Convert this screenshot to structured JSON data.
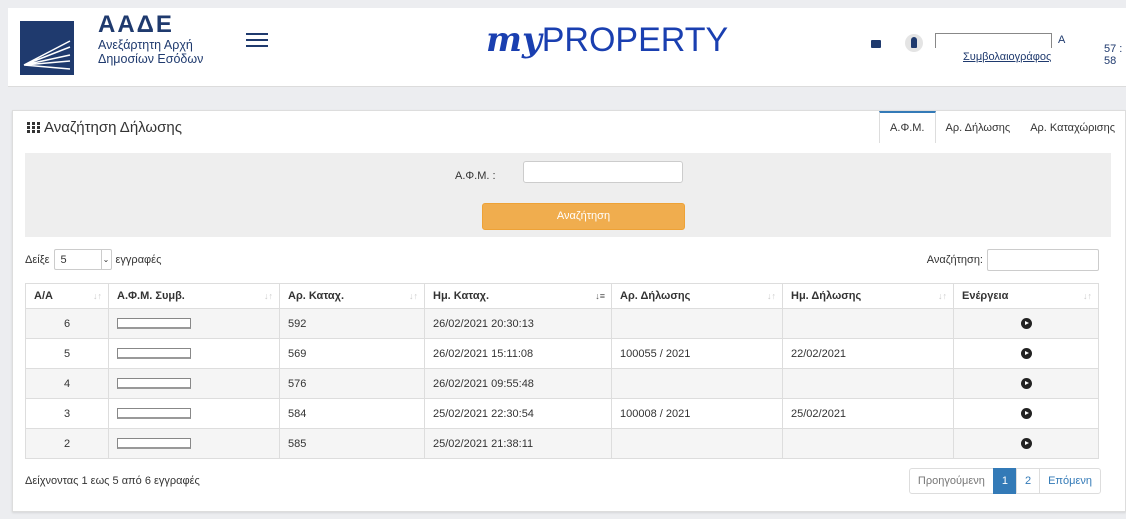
{
  "header": {
    "brand_title": "ΑΑΔΕ",
    "brand_line1": "Ανεξάρτητη Αρχή",
    "brand_line2": "Δημοσίων Εσόδων",
    "app_my": "my",
    "app_name": "PROPERTY",
    "user_suffix": "Α",
    "user_role": "Συμβολαιογράφος",
    "session_timer": "57 : 58"
  },
  "panel": {
    "title": "Αναζήτηση Δήλωσης",
    "tabs": [
      {
        "label": "Α.Φ.Μ."
      },
      {
        "label": "Αρ. Δήλωσης"
      },
      {
        "label": "Αρ. Καταχώρισης"
      }
    ]
  },
  "search": {
    "afm_label": "Α.Φ.Μ. :",
    "afm_value": "",
    "button_label": "Αναζήτηση"
  },
  "table_controls": {
    "show_label": "Δείξε",
    "page_length": "5",
    "records_label": "εγγραφές",
    "filter_label": "Αναζήτηση:"
  },
  "table": {
    "columns": [
      "Α/Α",
      "Α.Φ.Μ. Συμβ.",
      "Αρ. Καταχ.",
      "Ημ. Καταχ.",
      "Αρ. Δήλωσης",
      "Ημ. Δήλωσης",
      "Ενέργεια"
    ],
    "rows": [
      {
        "aa": "6",
        "kat": "592",
        "hm_kat": "26/02/2021 20:30:13",
        "ar_dil": "",
        "hm_dil": ""
      },
      {
        "aa": "5",
        "kat": "569",
        "hm_kat": "26/02/2021 15:11:08",
        "ar_dil": "100055 / 2021",
        "hm_dil": "22/02/2021"
      },
      {
        "aa": "4",
        "kat": "576",
        "hm_kat": "26/02/2021 09:55:48",
        "ar_dil": "",
        "hm_dil": ""
      },
      {
        "aa": "3",
        "kat": "584",
        "hm_kat": "25/02/2021 22:30:54",
        "ar_dil": "100008 / 2021",
        "hm_dil": "25/02/2021"
      },
      {
        "aa": "2",
        "kat": "585",
        "hm_kat": "25/02/2021 21:38:11",
        "ar_dil": "",
        "hm_dil": ""
      }
    ]
  },
  "footer": {
    "info": "Δείχνοντας 1 εως 5 από 6 εγγραφές",
    "prev": "Προηγούμενη",
    "pages": [
      "1",
      "2"
    ],
    "next": "Επόμενη"
  },
  "colors": {
    "brand_navy": "#1f3a6e",
    "search_button": "#f0ad4e",
    "active_page": "#337ab7"
  }
}
